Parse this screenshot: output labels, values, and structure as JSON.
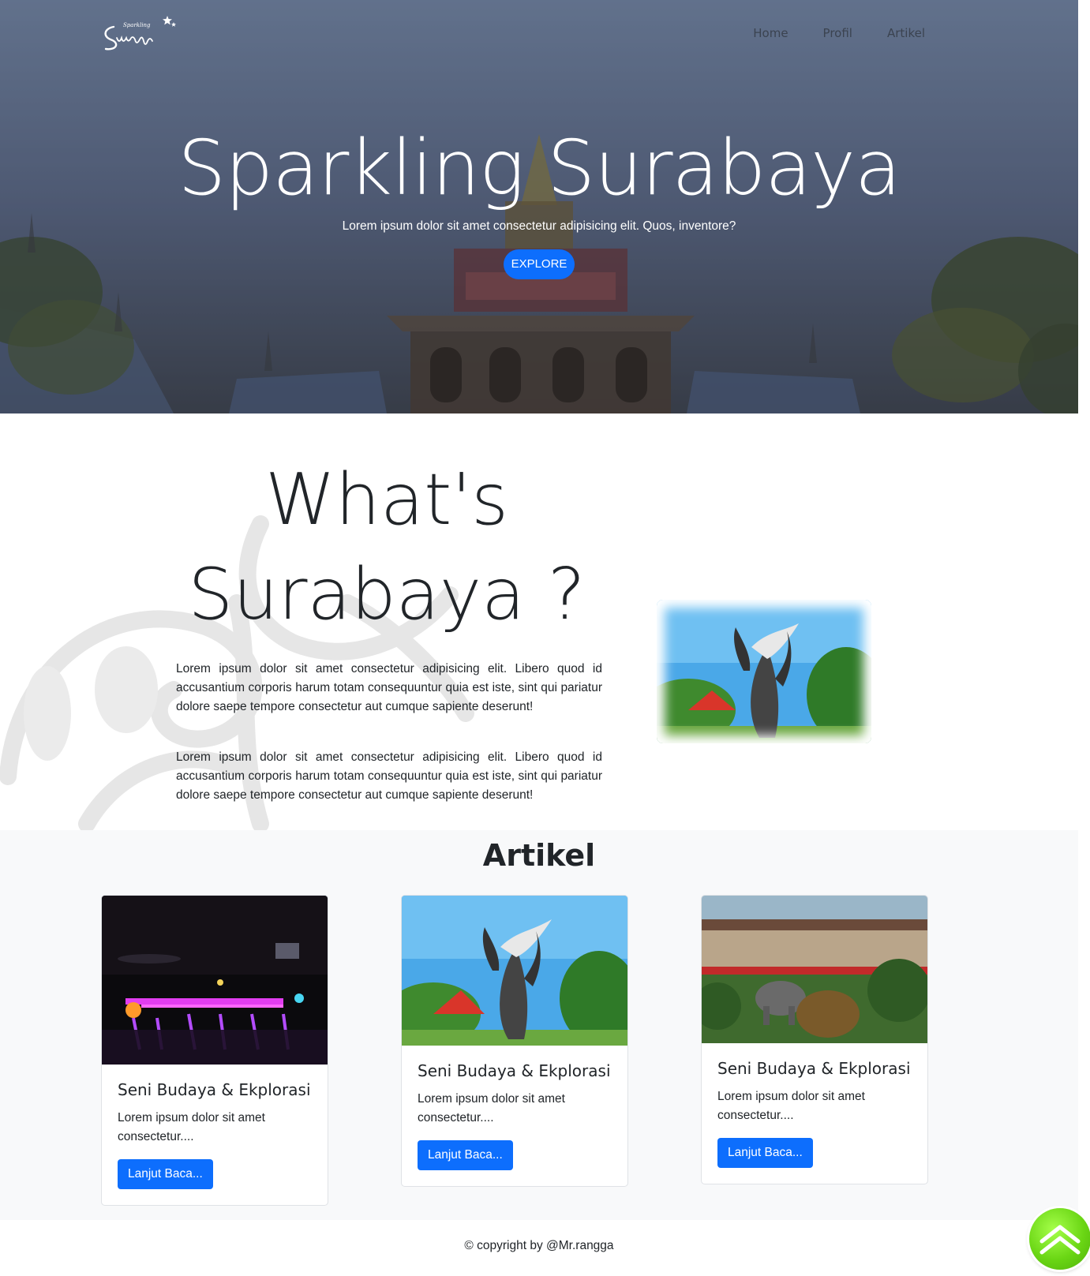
{
  "header": {
    "logo_text": "Sparkling Surabaya",
    "nav": [
      {
        "label": "Home"
      },
      {
        "label": "Profil"
      },
      {
        "label": "Artikel"
      }
    ]
  },
  "hero": {
    "title": "Sparkling Surabaya",
    "subtitle": "Lorem ipsum dolor sit amet consectetur adipisicing elit. Quos, inventore?",
    "cta_label": "EXPLORE",
    "cta_color": "#0d6efd"
  },
  "about": {
    "title": "What's Surabaya ?",
    "paragraphs": [
      "Lorem ipsum dolor sit amet consectetur adipisicing elit. Libero quod id accusantium corporis harum totam consequuntur quia est iste, sint qui pariatur dolore saepe tempore consectetur aut cumque sapiente deserunt!",
      "Lorem ipsum dolor sit amet consectetur adipisicing elit. Libero quod id accusantium corporis harum totam consequuntur quia est iste, sint qui pariatur dolore saepe tempore consectetur aut cumque sapiente deserunt!"
    ]
  },
  "articles": {
    "title": "Artikel",
    "cards": [
      {
        "title": "Seni Budaya & Ekplorasi",
        "text": "Lorem ipsum dolor sit amet consectetur....",
        "button": "Lanjut Baca..."
      },
      {
        "title": "Seni Budaya & Ekplorasi",
        "text": "Lorem ipsum dolor sit amet consectetur....",
        "button": "Lanjut Baca..."
      },
      {
        "title": "Seni Budaya & Ekplorasi",
        "text": "Lorem ipsum dolor sit amet consectetur....",
        "button": "Lanjut Baca..."
      }
    ]
  },
  "footer": {
    "copyright": "© copyright by @Mr.rangga"
  },
  "scroll_top": {
    "icon": "double-chevron-up-icon",
    "color": "#6ad614"
  }
}
